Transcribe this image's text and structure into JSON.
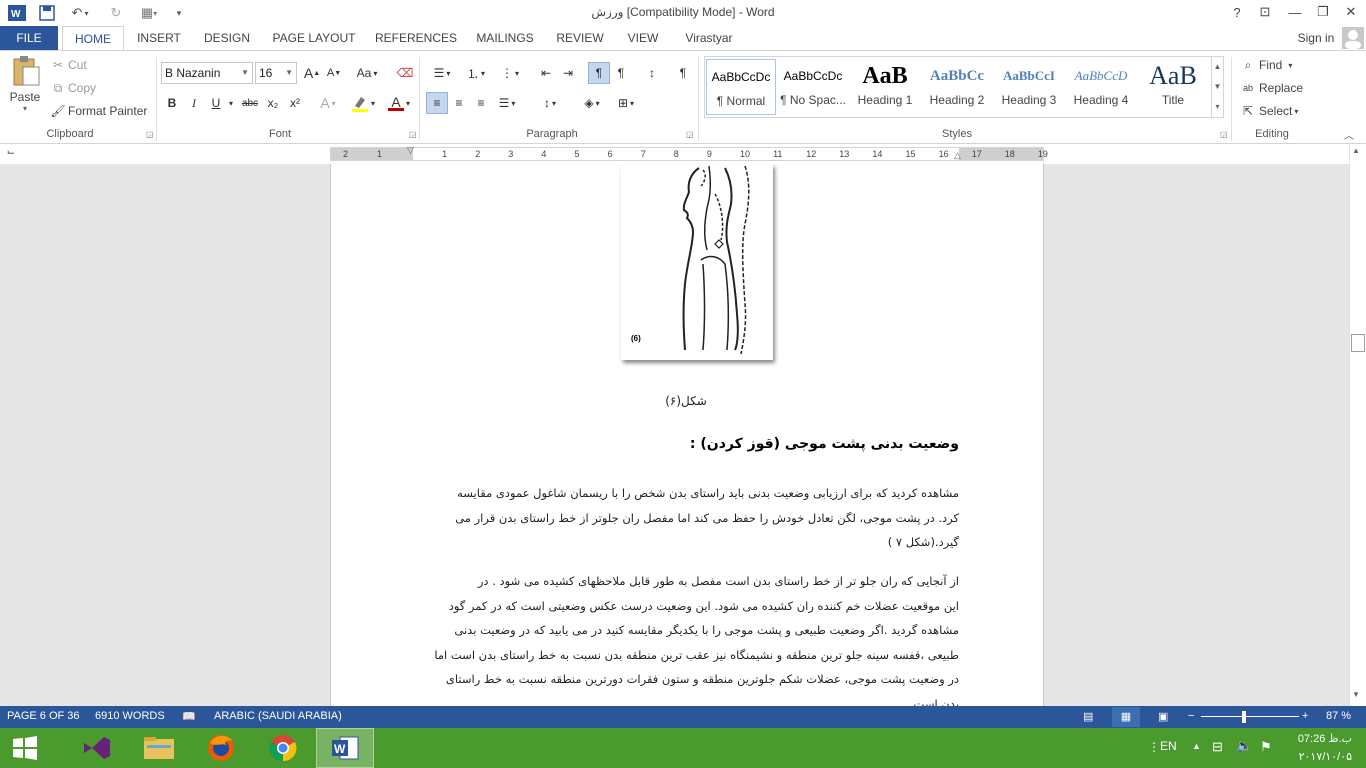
{
  "window": {
    "title": "ورزش [Compatibility Mode] - Word",
    "help_label": "?",
    "sign_in": "Sign in"
  },
  "tabs": [
    {
      "label": "FILE"
    },
    {
      "label": "HOME"
    },
    {
      "label": "INSERT"
    },
    {
      "label": "DESIGN"
    },
    {
      "label": "PAGE LAYOUT"
    },
    {
      "label": "REFERENCES"
    },
    {
      "label": "MAILINGS"
    },
    {
      "label": "REVIEW"
    },
    {
      "label": "VIEW"
    },
    {
      "label": "Virastyar"
    }
  ],
  "clipboard": {
    "paste": "Paste",
    "cut": "Cut",
    "copy": "Copy",
    "format_painter": "Format Painter",
    "group": "Clipboard"
  },
  "font": {
    "name": "B Nazanin",
    "size": "16",
    "group": "Font",
    "bold": "B",
    "italic": "I",
    "underline": "U",
    "strike": "abc",
    "sub": "x₂",
    "sup": "x²",
    "grow": "A",
    "shrink": "A",
    "case": "Aa",
    "effects": "A",
    "color_letter": "A",
    "highlight_color": "#ffff00",
    "font_color": "#c00000"
  },
  "paragraph": {
    "group": "Paragraph"
  },
  "styles": {
    "group": "Styles",
    "items": [
      {
        "preview": "AaBbCcDc",
        "name": "¶ Normal"
      },
      {
        "preview": "AaBbCcDc",
        "name": "¶ No Spac..."
      },
      {
        "preview": "AaB",
        "name": "Heading 1"
      },
      {
        "preview": "AaBbCc",
        "name": "Heading 2"
      },
      {
        "preview": "AaBbCcI",
        "name": "Heading 3"
      },
      {
        "preview": "AaBbCcD",
        "name": "Heading 4"
      },
      {
        "preview": "AaB",
        "name": "Title"
      }
    ]
  },
  "editing": {
    "group": "Editing",
    "find": "Find",
    "replace": "Replace",
    "select": "Select"
  },
  "ruler": {
    "left_numbers": [
      "2",
      "1"
    ],
    "numbers": [
      "1",
      "2",
      "3",
      "4",
      "5",
      "6",
      "7",
      "8",
      "9",
      "10",
      "11",
      "12",
      "13",
      "14",
      "15",
      "16",
      "17",
      "18",
      "19"
    ]
  },
  "document": {
    "figure_label": "(6)",
    "caption": "شکل(۶)",
    "heading": "وضعیت بدنی پشت موجی (قوز کردن) :",
    "para1": [
      "مشاهده کردید که برای ارزیابی وضعیت بدنی باید راستای بدن شخص را با ریسمان شاغول عمودی مقایسه",
      "کرد. در پشت موجی، لگن تعادل خودش را حفظ می کند اما مفصل ران جلوتر از خط راستای بدن قرار می",
      "گیرد.(شکل ۷ )"
    ],
    "para2": [
      "از آنجایی که ران جلو تر از خط راستای بدن است مفصل به طور قابل ملاحظهای کشیده می شود . در",
      "این موقعیت عضلات خم کننده ران کشیده می شود. این وضعیت درست عکس وضعیتی است که در کمر گود",
      "مشاهده گردید .اگر وضعیت طبیعی و پشت موجی را با یکدیگر مقایسه کنید در می یابید که در وضعیت بدنی",
      "طبیعی ،قفسه سینه جلو ترین منطقه و نشیمنگاه نیز عقب ترین منطقه بدن نسبت به خط راستای بدن است اما",
      "در وضعیت پشت موجی، عضلات شکم جلوترین منطقه و ستون فقرات دورترین منطقه نسبت به خط راستای",
      "بدن است."
    ]
  },
  "status": {
    "page": "PAGE 6 OF 36",
    "words": "6910 WORDS",
    "language": "ARABIC (SAUDI ARABIA)",
    "zoom": "87 %",
    "minus": "−",
    "plus": "+"
  },
  "taskbar": {
    "lang": "EN",
    "time": "07:26 ب.ظ",
    "date": "۲۰۱۷/۱۰/۰۵"
  }
}
